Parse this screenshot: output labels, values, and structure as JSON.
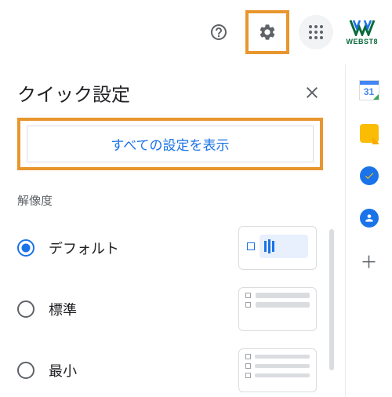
{
  "header": {
    "brand_text": "WEBST8"
  },
  "panel": {
    "title": "クイック設定",
    "all_settings_label": "すべての設定を表示"
  },
  "density": {
    "label": "解像度",
    "options": [
      {
        "label": "デフォルト",
        "checked": true
      },
      {
        "label": "標準",
        "checked": false
      },
      {
        "label": "最小",
        "checked": false
      }
    ]
  },
  "side": {
    "calendar_day": "31"
  },
  "icons": {
    "help": "help-icon",
    "settings": "gear-icon",
    "apps": "apps-icon",
    "close": "close-icon",
    "plus": "plus-icon"
  }
}
